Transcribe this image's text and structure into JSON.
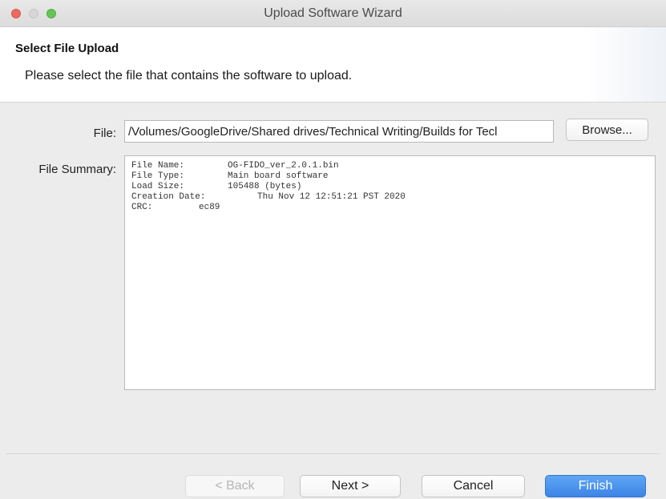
{
  "window": {
    "title": "Upload Software Wizard"
  },
  "header": {
    "title": "Select File Upload",
    "description": "Please select the file that contains the software to upload."
  },
  "form": {
    "file_label": "File:",
    "file_value": "/Volumes/GoogleDrive/Shared drives/Technical Writing/Builds for Tecl",
    "browse_label": "Browse...",
    "summary_label": "File Summary:",
    "summary": {
      "file_name_key": "File Name:",
      "file_name_value": "OG-FIDO_ver_2.0.1.bin",
      "file_type_key": "File Type:",
      "file_type_value": "Main board software",
      "load_size_key": "Load Size:",
      "load_size_value": "105488 (bytes)",
      "creation_date_key": "Creation Date:",
      "creation_date_value": "Thu Nov 12 12:51:21 PST 2020",
      "crc_key": "CRC:",
      "crc_value": "ec89"
    }
  },
  "footer": {
    "back_label": "< Back",
    "next_label": "Next >",
    "cancel_label": "Cancel",
    "finish_label": "Finish"
  },
  "colors": {
    "close": "#ec6a5f",
    "minimize": "#d7d7d7",
    "zoom": "#62c654",
    "accent": "#3d84e6"
  }
}
